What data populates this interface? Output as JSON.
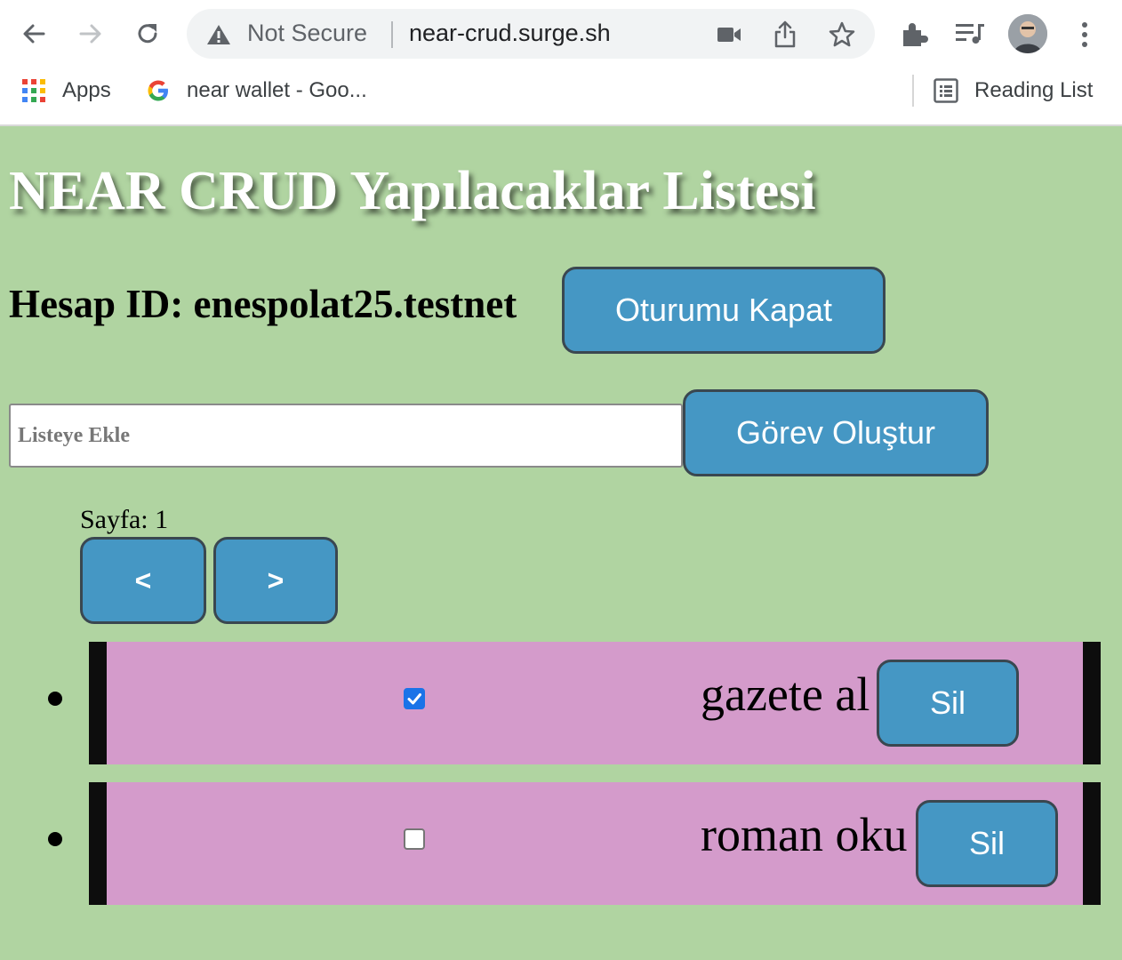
{
  "browser": {
    "security_label": "Not Secure",
    "url": "near-crud.surge.sh",
    "bookmarks": {
      "apps_label": "Apps",
      "google_label": "near wallet - Goo...",
      "reading_list_label": "Reading List"
    }
  },
  "page": {
    "title": "NEAR CRUD Yapılacaklar Listesi",
    "account_label": "Hesap ID: enespolat25.testnet",
    "logout_label": "Oturumu Kapat",
    "input_placeholder": "Listeye Ekle",
    "create_label": "Görev Oluştur",
    "page_label": "Sayfa: 1",
    "prev_label": "<",
    "next_label": ">",
    "todos": [
      {
        "text": "gazete al",
        "done": true,
        "delete_label": "Sil"
      },
      {
        "text": "roman oku",
        "done": false,
        "delete_label": "Sil"
      }
    ]
  },
  "colors": {
    "background": "#b0d4a1",
    "button": "#4597c4",
    "row": "#d49bcb",
    "row_border": "#0d0d0d"
  }
}
